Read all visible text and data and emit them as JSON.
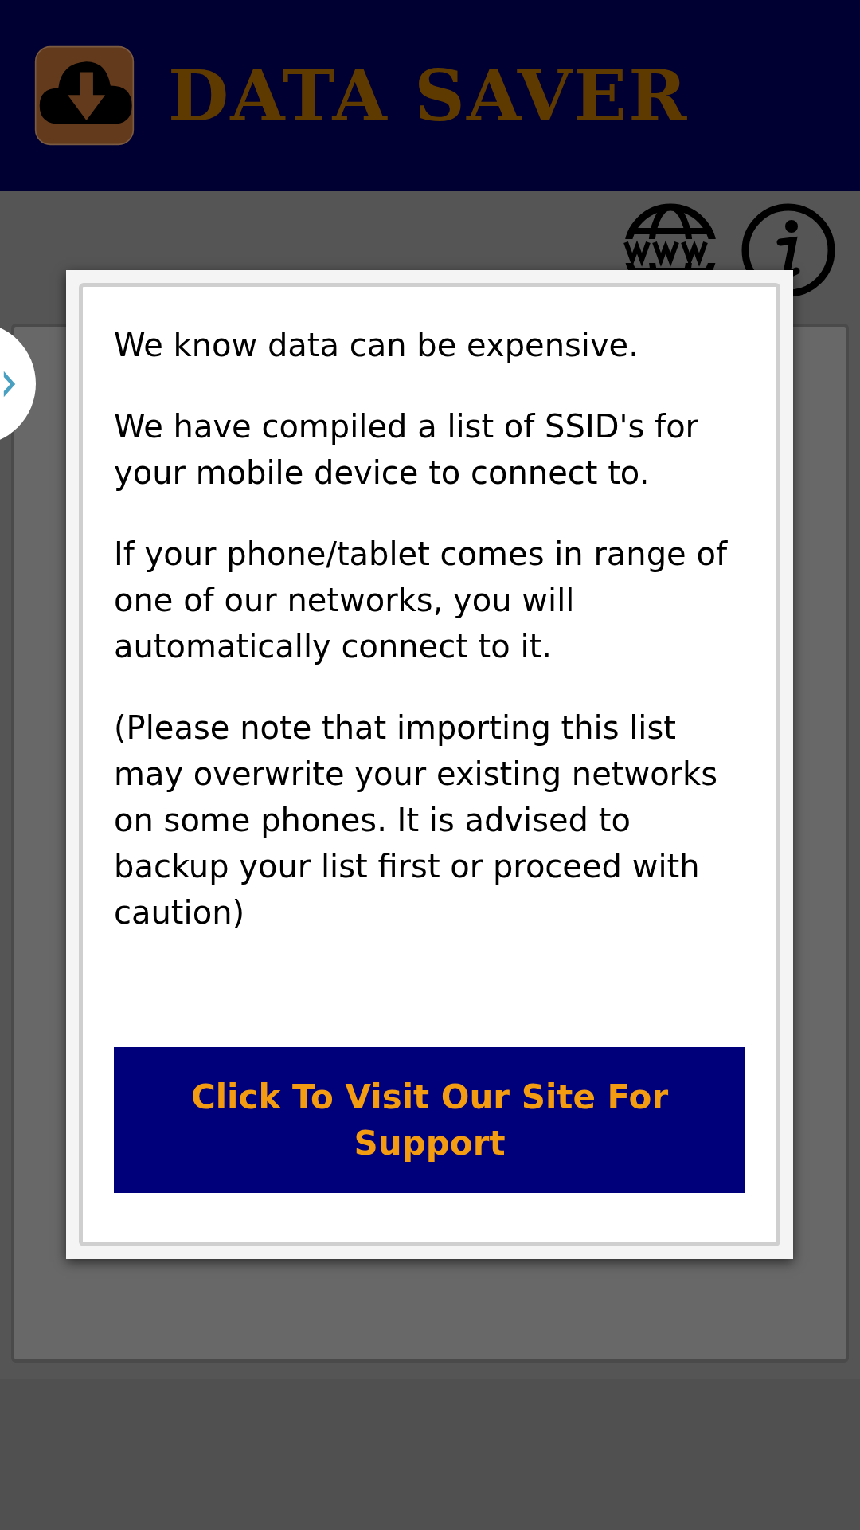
{
  "header": {
    "title": "DATA SAVER"
  },
  "dialog": {
    "paragraphs": [
      "We know data can be expensive.",
      "We have compiled a list of SSID's for your mobile device to connect to.",
      "If your phone/tablet comes in range of one of our networks, you will automatically connect to it.",
      "(Please note that importing this list may overwrite your existing networks on some phones. It is advised to backup your list first or proceed with caution)"
    ],
    "button": "Click To Visit Our Site For Support"
  }
}
